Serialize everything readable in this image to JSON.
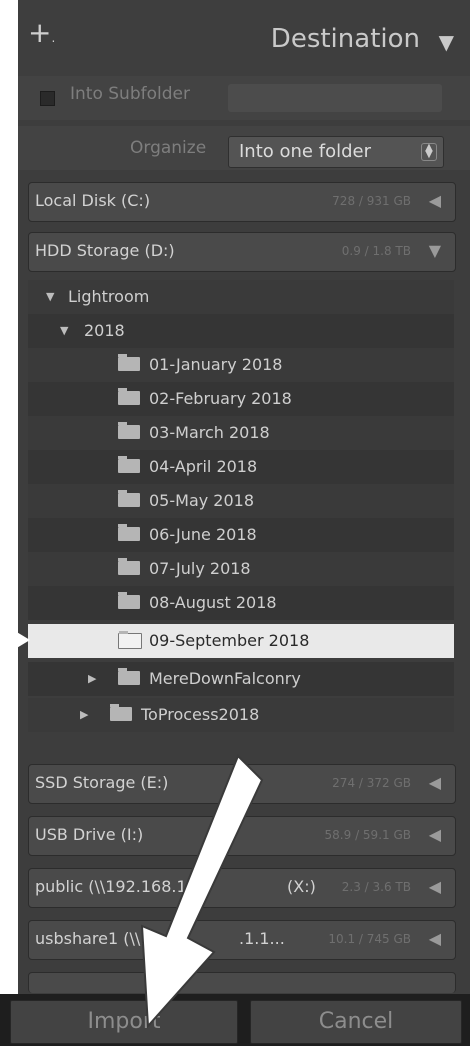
{
  "header": {
    "title": "Destination",
    "add_icon": "plus-icon",
    "collapse_icon": "triangle-down-icon"
  },
  "options": {
    "into_subfolder_label": "Into Subfolder",
    "into_subfolder_checked": false,
    "subfolder_value": "",
    "organize_label": "Organize",
    "organize_value": "Into one folder"
  },
  "volumes_top": [
    {
      "name": "Local Disk (C:)",
      "size": "728 / 931 GB",
      "expanded": false
    },
    {
      "name": "HDD Storage (D:)",
      "size": "0.9 / 1.8 TB",
      "expanded": true
    }
  ],
  "tree": {
    "lightroom": "Lightroom",
    "year": "2018",
    "folders": [
      "01-January 2018",
      "02-February 2018",
      "03-March 2018",
      "04-April 2018",
      "05-May 2018",
      "06-June 2018",
      "07-July 2018",
      "08-August 2018",
      "09-September 2018"
    ],
    "selected_folder": "09-September 2018",
    "collapsed_folders": [
      "MereDownFalconry",
      "ToProcess2018"
    ]
  },
  "volumes_bottom": [
    {
      "name": "SSD Storage (E:)",
      "size": "274 / 372 GB"
    },
    {
      "name": "USB Drive (I:)",
      "size": "58.9 / 59.1 GB"
    },
    {
      "name": "public (\\\\192.168.1",
      "name_tail": "(X:)",
      "size": "2.3 / 3.6 TB"
    },
    {
      "name": "usbshare1 (\\\\19",
      "name_tail": ".1.1...",
      "size": "10.1 / 745 GB"
    }
  ],
  "footer": {
    "import_label": "Import",
    "cancel_label": "Cancel"
  },
  "colors": {
    "panel_bg": "#3d3d3d",
    "selected_bg": "#e9e9e9",
    "arrow": "#ffffff"
  }
}
